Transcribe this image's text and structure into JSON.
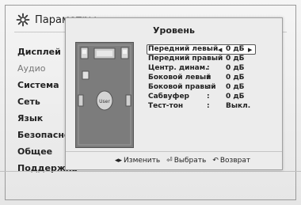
{
  "app": {
    "title": "Параметры"
  },
  "menu": [
    {
      "label": "Дисплей",
      "dim": false
    },
    {
      "label": "Аудио",
      "dim": true
    },
    {
      "label": "Система",
      "dim": false
    },
    {
      "label": "Сеть",
      "dim": false
    },
    {
      "label": "Язык",
      "dim": false
    },
    {
      "label": "Безопасность",
      "dim": false
    },
    {
      "label": "Общее",
      "dim": false
    },
    {
      "label": "Поддержка",
      "dim": false
    }
  ],
  "popup": {
    "title": "Уровень",
    "user_label": "User",
    "rows": [
      {
        "label": "Передний левый",
        "value": "0 дБ",
        "selected": true
      },
      {
        "label": "Передний правый",
        "value": "0 дБ",
        "selected": false
      },
      {
        "label": "Центр. динам.",
        "value": "0 дБ",
        "selected": false
      },
      {
        "label": "Боковой левый",
        "value": "0 дБ",
        "selected": false
      },
      {
        "label": "Боковой правый",
        "value": "0 дБ",
        "selected": false
      },
      {
        "label": "Сабвуфер",
        "value": "0 дБ",
        "selected": false
      },
      {
        "label": "Тест-тон",
        "value": "Выкл.",
        "selected": false
      }
    ],
    "footer": {
      "change": "Изменить",
      "select": "Выбрать",
      "back": "Возврат"
    }
  }
}
